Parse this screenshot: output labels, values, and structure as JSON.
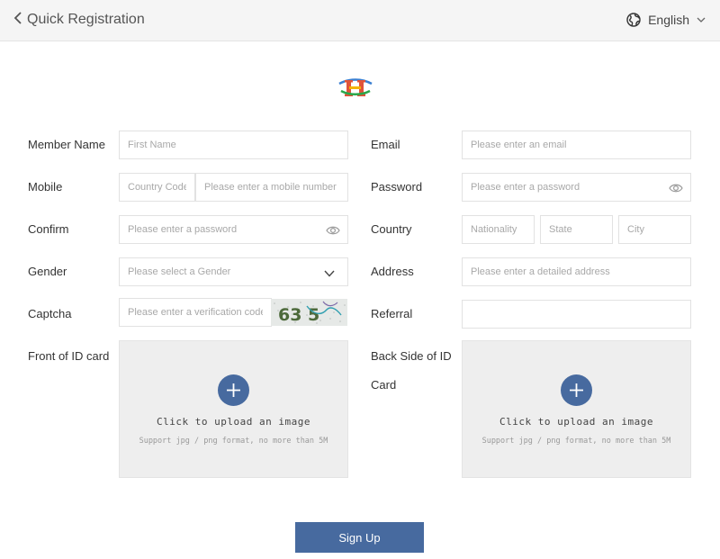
{
  "header": {
    "title": "Quick Registration",
    "language": "English"
  },
  "form": {
    "member_name": {
      "label": "Member Name",
      "placeholder": "First Name"
    },
    "email": {
      "label": "Email",
      "placeholder": "Please enter an email"
    },
    "mobile": {
      "label": "Mobile",
      "country_code_placeholder": "Country Code",
      "placeholder": "Please enter a mobile number"
    },
    "password": {
      "label": "Password",
      "placeholder": "Please enter a password"
    },
    "confirm": {
      "label": "Confirm",
      "placeholder": "Please enter a password"
    },
    "country": {
      "label": "Country",
      "nationality_placeholder": "Nationality",
      "state_placeholder": "State",
      "city_placeholder": "City"
    },
    "gender": {
      "label": "Gender",
      "placeholder": "Please select a Gender"
    },
    "address": {
      "label": "Address",
      "placeholder": "Please enter a detailed address"
    },
    "captcha": {
      "label": "Captcha",
      "placeholder": "Please enter a verification code",
      "image_text": "63 5"
    },
    "referral": {
      "label": "Referral",
      "value": ""
    },
    "front_id": {
      "label": "Front of ID card",
      "upload_title": "Click to upload an image",
      "upload_hint": "Support jpg / png format, no more than 5M"
    },
    "back_id": {
      "label_line1": "Back Side of ID",
      "label_line2": "Card",
      "upload_title": "Click to upload an image",
      "upload_hint": "Support jpg / png format, no more than 5M"
    }
  },
  "submit_label": "Sign Up",
  "colors": {
    "accent": "#476a9f",
    "header_bg": "#f5f5f5",
    "upload_bg": "#eeeeee"
  }
}
